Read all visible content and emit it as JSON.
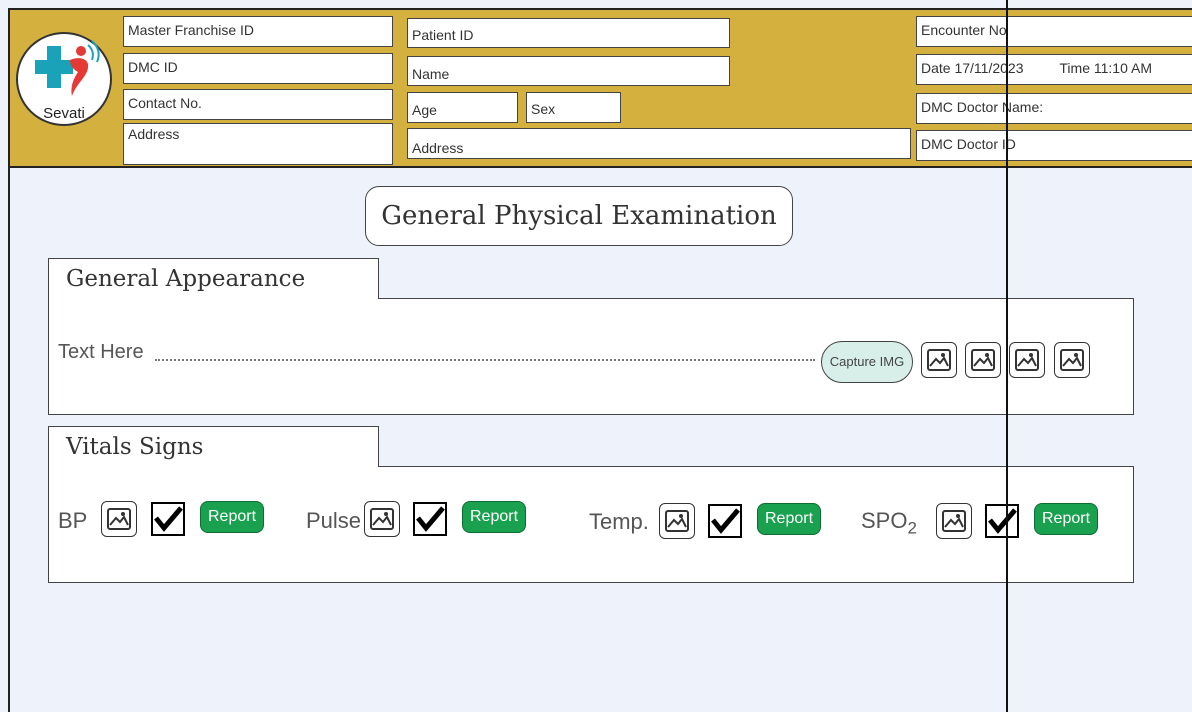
{
  "header": {
    "logo_text": "Sevati",
    "master_franchise_id": "Master Franchise ID",
    "dmc_id": "DMC ID",
    "contact_no": "Contact No.",
    "address_left": "Address",
    "patient_id": "Patient ID",
    "name": "Name",
    "age": "Age",
    "sex": "Sex",
    "address_mid": "Address",
    "encounter_no": "Encounter No",
    "date": "Date 17/11/2023",
    "time": "Time 11:10 AM",
    "dmc_doctor_name": "DMC Doctor Name:",
    "dmc_doctor_id": "DMC Doctor ID"
  },
  "page_title": "General Physical Examination",
  "general_appearance": {
    "title": "General Appearance",
    "text_placeholder": "Text Here",
    "capture_label": "Capture IMG"
  },
  "vitals": {
    "title": "Vitals Signs",
    "report_label": "Report",
    "bp": "BP",
    "pulse": "Pulse",
    "temp": "Temp.",
    "spo_base": "SPO",
    "spo_sub": "2"
  },
  "colors": {
    "header_bg": "#d4b13f",
    "report_green": "#1aa14f",
    "capture_bg": "#d7efe8",
    "page_bg": "#eef3fb"
  }
}
